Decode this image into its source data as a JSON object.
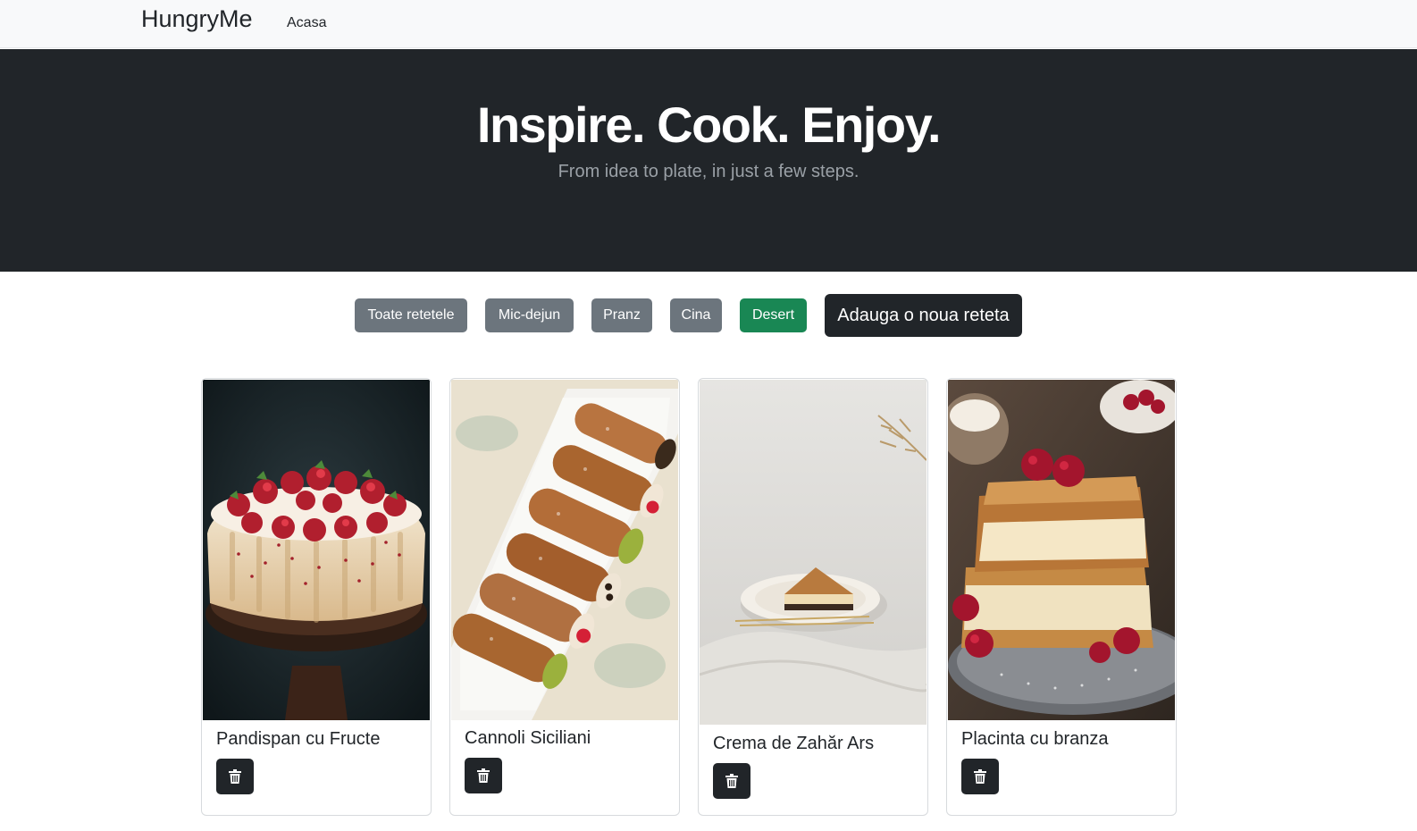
{
  "navbar": {
    "brand": "HungryMe",
    "links": [
      {
        "label": "Acasa"
      }
    ]
  },
  "hero": {
    "title": "Inspire. Cook. Enjoy.",
    "subtitle": "From idea to plate, in just a few steps."
  },
  "filters": [
    {
      "label": "Toate retetele",
      "variant": "secondary"
    },
    {
      "label": "Mic-dejun",
      "variant": "secondary"
    },
    {
      "label": "Pranz",
      "variant": "secondary"
    },
    {
      "label": "Cina",
      "variant": "secondary"
    },
    {
      "label": "Desert",
      "variant": "success"
    }
  ],
  "add_button": {
    "label": "Adauga o noua reteta"
  },
  "recipes": [
    {
      "title": "Pandispan cu Fructe",
      "image": "strawberry-bundt-cake"
    },
    {
      "title": "Cannoli Siciliani",
      "image": "cannoli-platter"
    },
    {
      "title": "Crema de Zahăr Ars",
      "image": "cheesecake-slice-plate"
    },
    {
      "title": "Placinta cu branza",
      "image": "cheese-pie-raspberries"
    }
  ],
  "icons": {
    "delete": "trash-icon"
  },
  "colors": {
    "hero_bg": "#212529",
    "secondary": "#6c757d",
    "success": "#198754",
    "dark": "#212529",
    "navbar_bg": "#f8f9fa"
  }
}
